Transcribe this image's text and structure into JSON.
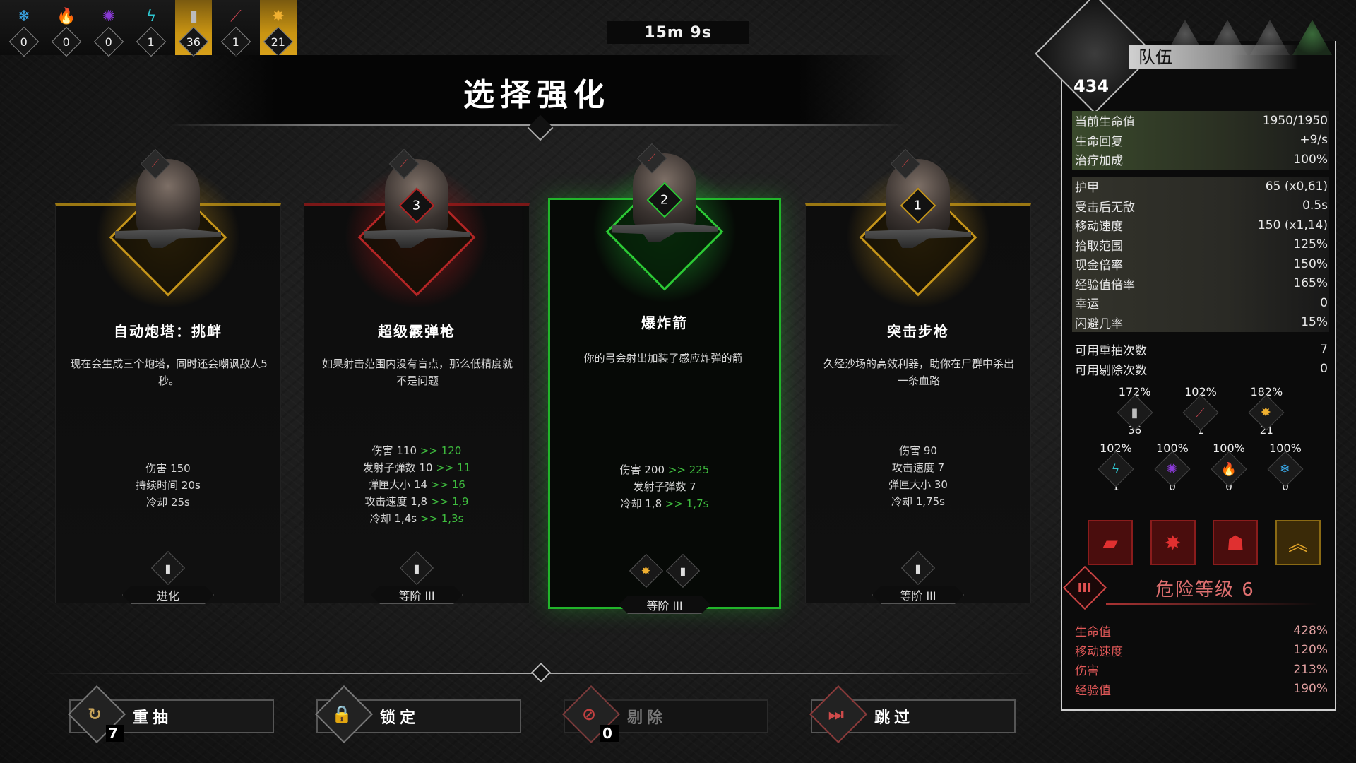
{
  "resources": [
    {
      "icon": "frost-icon",
      "glyph": "❄",
      "color": "#3aa8e8",
      "count": "0",
      "highlight": false
    },
    {
      "icon": "fire-icon",
      "glyph": "🔥",
      "color": "#e0541e",
      "count": "0",
      "highlight": false
    },
    {
      "icon": "poison-icon",
      "glyph": "✺",
      "color": "#8a3ad8",
      "count": "0",
      "highlight": false
    },
    {
      "icon": "lightning-icon",
      "glyph": "ϟ",
      "color": "#2ec6d0",
      "count": "1",
      "highlight": false
    },
    {
      "icon": "bullet-icon",
      "glyph": "▮",
      "color": "#bbbbbb",
      "count": "36",
      "highlight": true
    },
    {
      "icon": "blade-icon",
      "glyph": "⟋",
      "color": "#c0424e",
      "count": "1",
      "highlight": false
    },
    {
      "icon": "explosion-icon",
      "glyph": "✸",
      "color": "#f0b030",
      "count": "21",
      "highlight": true
    }
  ],
  "timer": "15m 9s",
  "title": "选择强化",
  "cards": [
    {
      "name": "自动炮塔：挑衅",
      "rank": "",
      "desc": "现在会生成三个炮塔，同时还会嘲讽敌人5 秒。",
      "stats": [
        {
          "label": "伤害 150",
          "up": ""
        },
        {
          "label": "持续时间 20s",
          "up": ""
        },
        {
          "label": "冷却 25s",
          "up": ""
        }
      ],
      "tier": "进化",
      "theme": "gold"
    },
    {
      "name": "超级霰弹枪",
      "rank": "3",
      "desc": "如果射击范围内没有盲点，那么低精度就不是问题",
      "stats": [
        {
          "label": "伤害 110",
          "up": ">> 120"
        },
        {
          "label": "发射子弹数 10",
          "up": ">> 11"
        },
        {
          "label": "弹匣大小 14",
          "up": ">> 16"
        },
        {
          "label": "攻击速度 1,8",
          "up": ">> 1,9"
        },
        {
          "label": "冷却 1,4s",
          "up": ">> 1,3s"
        }
      ],
      "tier": "等阶 III",
      "theme": "red"
    },
    {
      "name": "爆炸箭",
      "rank": "2",
      "desc": "你的弓会射出加装了感应炸弹的箭",
      "stats": [
        {
          "label": "伤害 200",
          "up": ">> 225"
        },
        {
          "label": "发射子弹数 7",
          "up": ""
        },
        {
          "label": "冷却 1,8",
          "up": ">> 1,7s"
        }
      ],
      "tier": "等阶 III",
      "theme": "green"
    },
    {
      "name": "突击步枪",
      "rank": "1",
      "desc": "久经沙场的高效利器，助你在尸群中杀出一条血路",
      "stats": [
        {
          "label": "伤害 90",
          "up": ""
        },
        {
          "label": "攻击速度 7",
          "up": ""
        },
        {
          "label": "弹匣大小 30",
          "up": ""
        },
        {
          "label": "冷却 1,75s",
          "up": ""
        }
      ],
      "tier": "等阶 III",
      "theme": "gold"
    }
  ],
  "buttons": {
    "reroll": {
      "label": "重抽",
      "count": "7"
    },
    "lock": {
      "label": "锁定"
    },
    "banish": {
      "label": "剔除",
      "count": "0"
    },
    "skip": {
      "label": "跳过"
    }
  },
  "panel": {
    "team_label": "队伍",
    "level": "434",
    "health": [
      {
        "k": "当前生命值",
        "v": "1950/1950"
      },
      {
        "k": "生命回复",
        "v": "+9/s"
      },
      {
        "k": "治疗加成",
        "v": "100%"
      }
    ],
    "defense": [
      {
        "k": "护甲",
        "v": "65 (x0,61)"
      },
      {
        "k": "受击后无敌",
        "v": "0.5s"
      },
      {
        "k": "移动速度",
        "v": "150 (x1,14)"
      },
      {
        "k": "拾取范围",
        "v": "125%"
      },
      {
        "k": "现金倍率",
        "v": "150%"
      },
      {
        "k": "经验值倍率",
        "v": "165%"
      },
      {
        "k": "幸运",
        "v": "0"
      },
      {
        "k": "闪避几率",
        "v": "15%"
      }
    ],
    "rerolls": [
      {
        "k": "可用重抽次数",
        "v": "7"
      },
      {
        "k": "可用剔除次数",
        "v": "0"
      }
    ],
    "res_row1": [
      {
        "pct": "172%",
        "icon": "bullet-icon",
        "glyph": "▮",
        "color": "#bbbbbb",
        "count": "36"
      },
      {
        "pct": "102%",
        "icon": "blade-icon",
        "glyph": "⟋",
        "color": "#c0424e",
        "count": "1"
      },
      {
        "pct": "182%",
        "icon": "explosion-icon",
        "glyph": "✸",
        "color": "#f0b030",
        "count": "21"
      }
    ],
    "res_row2": [
      {
        "pct": "102%",
        "icon": "lightning-icon",
        "glyph": "ϟ",
        "color": "#2ec6d0",
        "count": "1"
      },
      {
        "pct": "100%",
        "icon": "poison-icon",
        "glyph": "✺",
        "color": "#8a3ad8",
        "count": "0"
      },
      {
        "pct": "100%",
        "icon": "fire-icon",
        "glyph": "🔥",
        "color": "#e0541e",
        "count": "0"
      },
      {
        "pct": "100%",
        "icon": "frost-icon",
        "glyph": "❄",
        "color": "#3aa8e8",
        "count": "0"
      }
    ],
    "danger_label": "危险等级 6",
    "danger_icon": "III",
    "danger_stats": [
      {
        "k": "生命值",
        "v": "428%"
      },
      {
        "k": "移动速度",
        "v": "120%"
      },
      {
        "k": "伤害",
        "v": "213%"
      },
      {
        "k": "经验值",
        "v": "190%"
      }
    ]
  }
}
